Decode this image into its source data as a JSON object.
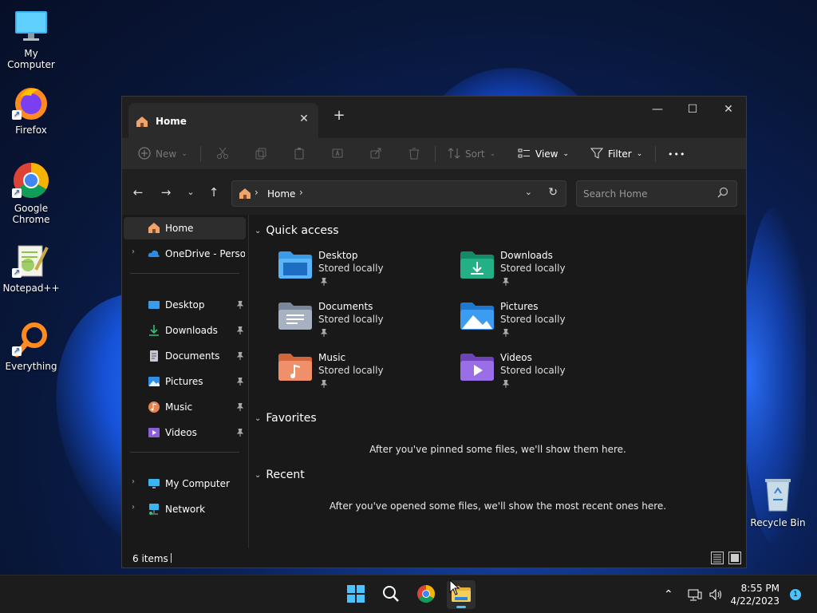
{
  "desktop": {
    "icons": [
      {
        "label": "My Computer"
      },
      {
        "label": "Firefox"
      },
      {
        "label": "Google Chrome"
      },
      {
        "label": "Notepad++"
      },
      {
        "label": "Everything"
      },
      {
        "label": "Recycle Bin"
      }
    ]
  },
  "window": {
    "tab_title": "Home",
    "new_tab_symbol": "+",
    "controls": {
      "minimize": "—",
      "maximize": "☐",
      "close": "✕"
    }
  },
  "toolbar": {
    "new_label": "New",
    "sort_label": "Sort",
    "view_label": "View",
    "filter_label": "Filter",
    "more_label": "•••"
  },
  "address": {
    "crumb": "Home",
    "search_placeholder": "Search Home"
  },
  "sidebar": {
    "items": [
      {
        "label": "Home"
      },
      {
        "label": "OneDrive - Persona"
      },
      {
        "label": "Desktop"
      },
      {
        "label": "Downloads"
      },
      {
        "label": "Documents"
      },
      {
        "label": "Pictures"
      },
      {
        "label": "Music"
      },
      {
        "label": "Videos"
      },
      {
        "label": "My Computer"
      },
      {
        "label": "Network"
      }
    ]
  },
  "content": {
    "quick_access_title": "Quick access",
    "favorites_title": "Favorites",
    "recent_title": "Recent",
    "favorites_empty": "After you've pinned some files, we'll show them here.",
    "recent_empty": "After you've opened some files, we'll show the most recent ones here.",
    "quick_access": [
      {
        "name": "Desktop",
        "sub": "Stored locally",
        "color": "#3a9be8"
      },
      {
        "name": "Downloads",
        "sub": "Stored locally",
        "color": "#1fa37a"
      },
      {
        "name": "Documents",
        "sub": "Stored locally",
        "color": "#8e9bb0"
      },
      {
        "name": "Pictures",
        "sub": "Stored locally",
        "color": "#2f8fe6"
      },
      {
        "name": "Music",
        "sub": "Stored locally",
        "color": "#e7834f"
      },
      {
        "name": "Videos",
        "sub": "Stored locally",
        "color": "#8b5fd6"
      }
    ]
  },
  "status": {
    "item_count": "6 items"
  },
  "taskbar": {
    "time": "8:55 PM",
    "date": "4/22/2023",
    "notification_count": "1",
    "accent": "#4cc2ff"
  }
}
